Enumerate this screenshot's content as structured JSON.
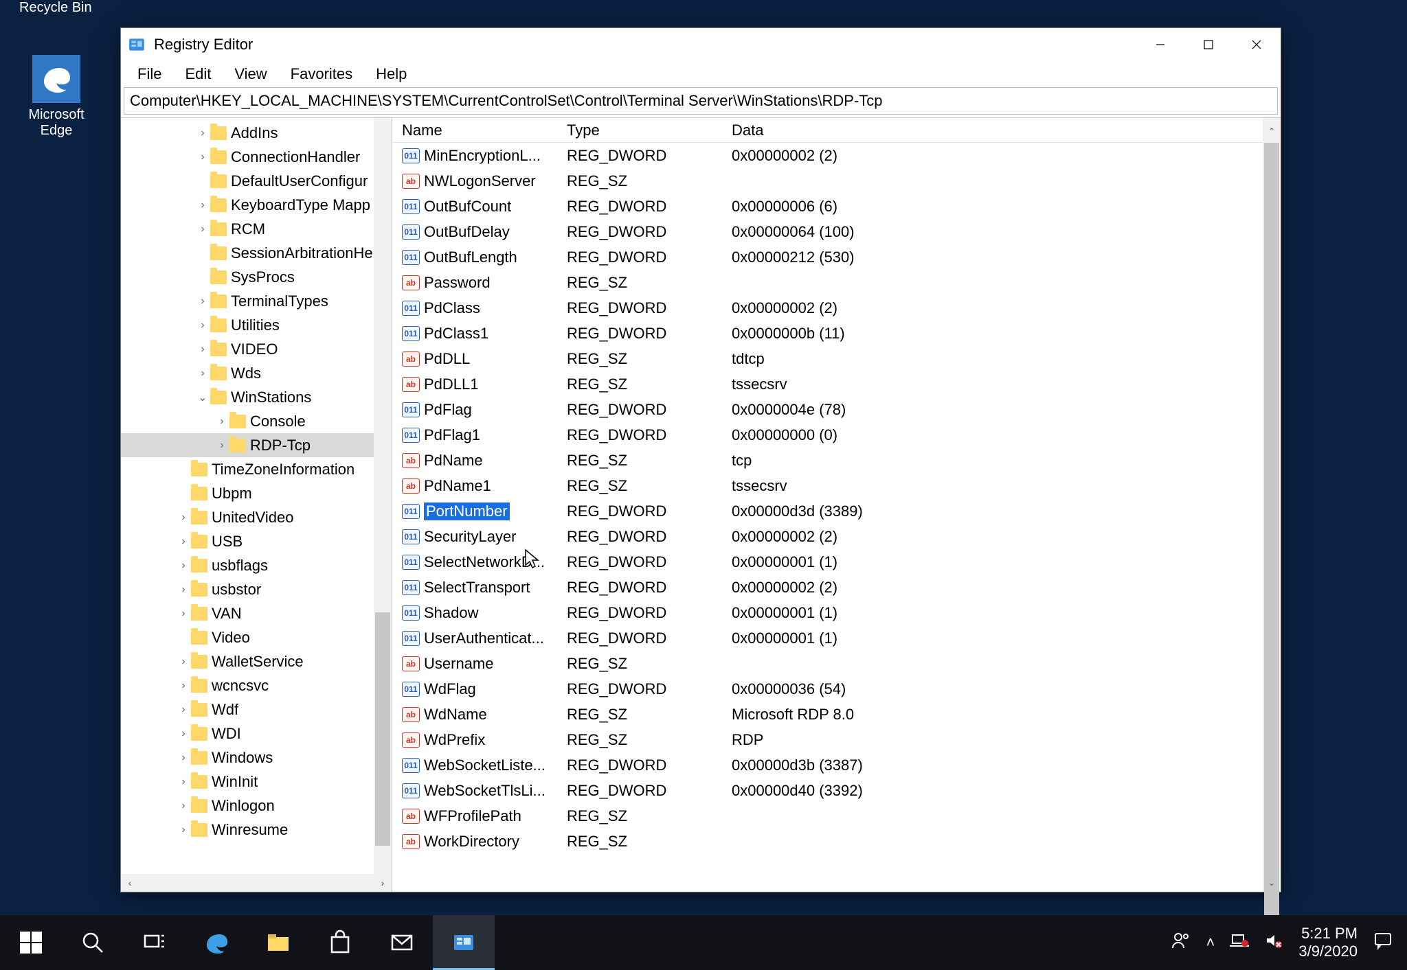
{
  "desktop": {
    "recycle_label": "Recycle Bin",
    "edge_label": "Microsoft Edge"
  },
  "window": {
    "title": "Registry Editor",
    "menus": [
      "File",
      "Edit",
      "View",
      "Favorites",
      "Help"
    ],
    "address": "Computer\\HKEY_LOCAL_MACHINE\\SYSTEM\\CurrentControlSet\\Control\\Terminal Server\\WinStations\\RDP-Tcp"
  },
  "tree": [
    {
      "indent": 0,
      "exp": "›",
      "label": "AddIns"
    },
    {
      "indent": 0,
      "exp": "›",
      "label": "ConnectionHandler"
    },
    {
      "indent": 0,
      "exp": "",
      "label": "DefaultUserConfigur"
    },
    {
      "indent": 0,
      "exp": "›",
      "label": "KeyboardType Mapp"
    },
    {
      "indent": 0,
      "exp": "›",
      "label": "RCM"
    },
    {
      "indent": 0,
      "exp": "",
      "label": "SessionArbitrationHe"
    },
    {
      "indent": 0,
      "exp": "",
      "label": "SysProcs"
    },
    {
      "indent": 0,
      "exp": "›",
      "label": "TerminalTypes"
    },
    {
      "indent": 0,
      "exp": "›",
      "label": "Utilities"
    },
    {
      "indent": 0,
      "exp": "›",
      "label": "VIDEO"
    },
    {
      "indent": 0,
      "exp": "›",
      "label": "Wds"
    },
    {
      "indent": 0,
      "exp": "⌄",
      "label": "WinStations"
    },
    {
      "indent": 1,
      "exp": "›",
      "label": "Console"
    },
    {
      "indent": 1,
      "exp": "›",
      "label": "RDP-Tcp",
      "selected": true
    },
    {
      "indent": -1,
      "exp": "",
      "label": "TimeZoneInformation"
    },
    {
      "indent": -1,
      "exp": "",
      "label": "Ubpm"
    },
    {
      "indent": -1,
      "exp": "›",
      "label": "UnitedVideo"
    },
    {
      "indent": -1,
      "exp": "›",
      "label": "USB"
    },
    {
      "indent": -1,
      "exp": "›",
      "label": "usbflags"
    },
    {
      "indent": -1,
      "exp": "›",
      "label": "usbstor"
    },
    {
      "indent": -1,
      "exp": "›",
      "label": "VAN"
    },
    {
      "indent": -1,
      "exp": "",
      "label": "Video"
    },
    {
      "indent": -1,
      "exp": "›",
      "label": "WalletService"
    },
    {
      "indent": -1,
      "exp": "›",
      "label": "wcncsvc"
    },
    {
      "indent": -1,
      "exp": "›",
      "label": "Wdf"
    },
    {
      "indent": -1,
      "exp": "›",
      "label": "WDI"
    },
    {
      "indent": -1,
      "exp": "›",
      "label": "Windows"
    },
    {
      "indent": -1,
      "exp": "›",
      "label": "WinInit"
    },
    {
      "indent": -1,
      "exp": "›",
      "label": "Winlogon"
    },
    {
      "indent": -1,
      "exp": "›",
      "label": "Winresume"
    }
  ],
  "columns": {
    "name": "Name",
    "type": "Type",
    "data": "Data"
  },
  "values": [
    {
      "icon": "dw",
      "name": "MinEncryptionL...",
      "type": "REG_DWORD",
      "data": "0x00000002 (2)"
    },
    {
      "icon": "sz",
      "name": "NWLogonServer",
      "type": "REG_SZ",
      "data": ""
    },
    {
      "icon": "dw",
      "name": "OutBufCount",
      "type": "REG_DWORD",
      "data": "0x00000006 (6)"
    },
    {
      "icon": "dw",
      "name": "OutBufDelay",
      "type": "REG_DWORD",
      "data": "0x00000064 (100)"
    },
    {
      "icon": "dw",
      "name": "OutBufLength",
      "type": "REG_DWORD",
      "data": "0x00000212 (530)"
    },
    {
      "icon": "sz",
      "name": "Password",
      "type": "REG_SZ",
      "data": ""
    },
    {
      "icon": "dw",
      "name": "PdClass",
      "type": "REG_DWORD",
      "data": "0x00000002 (2)"
    },
    {
      "icon": "dw",
      "name": "PdClass1",
      "type": "REG_DWORD",
      "data": "0x0000000b (11)"
    },
    {
      "icon": "sz",
      "name": "PdDLL",
      "type": "REG_SZ",
      "data": "tdtcp"
    },
    {
      "icon": "sz",
      "name": "PdDLL1",
      "type": "REG_SZ",
      "data": "tssecsrv"
    },
    {
      "icon": "dw",
      "name": "PdFlag",
      "type": "REG_DWORD",
      "data": "0x0000004e (78)"
    },
    {
      "icon": "dw",
      "name": "PdFlag1",
      "type": "REG_DWORD",
      "data": "0x00000000 (0)"
    },
    {
      "icon": "sz",
      "name": "PdName",
      "type": "REG_SZ",
      "data": "tcp"
    },
    {
      "icon": "sz",
      "name": "PdName1",
      "type": "REG_SZ",
      "data": "tssecsrv"
    },
    {
      "icon": "dw",
      "name": "PortNumber",
      "type": "REG_DWORD",
      "data": "0x00000d3d (3389)",
      "selected": true
    },
    {
      "icon": "dw",
      "name": "SecurityLayer",
      "type": "REG_DWORD",
      "data": "0x00000002 (2)"
    },
    {
      "icon": "dw",
      "name": "SelectNetworkD...",
      "type": "REG_DWORD",
      "data": "0x00000001 (1)"
    },
    {
      "icon": "dw",
      "name": "SelectTransport",
      "type": "REG_DWORD",
      "data": "0x00000002 (2)"
    },
    {
      "icon": "dw",
      "name": "Shadow",
      "type": "REG_DWORD",
      "data": "0x00000001 (1)"
    },
    {
      "icon": "dw",
      "name": "UserAuthenticat...",
      "type": "REG_DWORD",
      "data": "0x00000001 (1)"
    },
    {
      "icon": "sz",
      "name": "Username",
      "type": "REG_SZ",
      "data": ""
    },
    {
      "icon": "dw",
      "name": "WdFlag",
      "type": "REG_DWORD",
      "data": "0x00000036 (54)"
    },
    {
      "icon": "sz",
      "name": "WdName",
      "type": "REG_SZ",
      "data": "Microsoft RDP 8.0"
    },
    {
      "icon": "sz",
      "name": "WdPrefix",
      "type": "REG_SZ",
      "data": "RDP"
    },
    {
      "icon": "dw",
      "name": "WebSocketListe...",
      "type": "REG_DWORD",
      "data": "0x00000d3b (3387)"
    },
    {
      "icon": "dw",
      "name": "WebSocketTlsLi...",
      "type": "REG_DWORD",
      "data": "0x00000d40 (3392)"
    },
    {
      "icon": "sz",
      "name": "WFProfilePath",
      "type": "REG_SZ",
      "data": ""
    },
    {
      "icon": "sz",
      "name": "WorkDirectory",
      "type": "REG_SZ",
      "data": ""
    }
  ],
  "taskbar": {
    "time": "5:21 PM",
    "date": "3/9/2020"
  }
}
